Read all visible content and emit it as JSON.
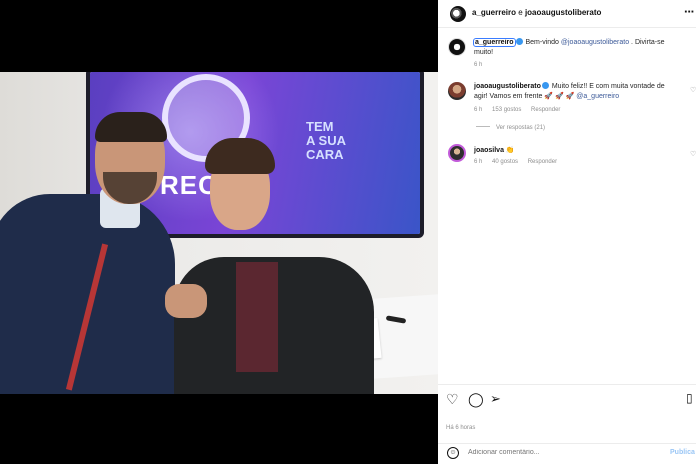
{
  "post": {
    "header": {
      "user1": "a_guerreiro",
      "connector": " e ",
      "user2": "joaoaugustoliberato"
    },
    "photo": {
      "tv_logo": "RECO",
      "tagline": [
        "TEM",
        "A SUA",
        "CARA"
      ]
    },
    "comments": [
      {
        "user": "a_guerreiro",
        "text": " Bem-vindo ",
        "mention": "@joaoaugustoliberato",
        "text2": " . Divirta-se muito!",
        "time": "6 h"
      },
      {
        "user": "joaoaugustoliberato",
        "text": " Muito feliz!! E com muita vontade de agir! Vamos em frente 🚀 🚀 🚀 ",
        "mention": "@a_guerreiro",
        "time": "6 h",
        "likes": "153 gostos",
        "reply": "Responder",
        "view_replies": "Ver respostas (21)"
      },
      {
        "user": "joaosilva",
        "text": " 👏",
        "time": "6 h",
        "likes": "40 gostos",
        "reply": "Responder"
      }
    ],
    "time_ago": "Há 6 horas",
    "add_comment_placeholder": "Adicionar comentário...",
    "publish_label": "Publica"
  }
}
